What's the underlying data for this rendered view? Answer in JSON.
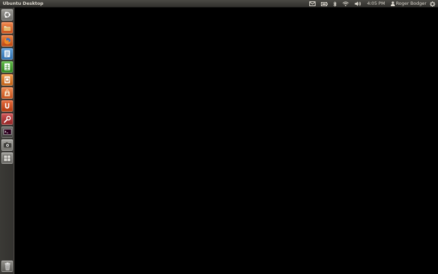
{
  "top_panel": {
    "window_title": "Ubuntu Desktop",
    "indicators": {
      "mail_icon": "envelope-icon",
      "battery_icon": "battery-icon",
      "bluetooth_icon": "bluetooth-icon",
      "network_icon": "wifi-icon",
      "sound_icon": "speaker-icon",
      "clock": "4:05 PM",
      "user_name": "Roger Bodger",
      "session_icon": "gear-icon"
    }
  },
  "launcher": {
    "items": [
      {
        "name": "dash-home",
        "icon": "ubuntu-logo-icon",
        "color": "#8d8c87"
      },
      {
        "name": "files",
        "icon": "folder-icon",
        "color": "#e1652b"
      },
      {
        "name": "firefox",
        "icon": "firefox-icon",
        "color": "#d35a1e"
      },
      {
        "name": "writer",
        "icon": "writer-document-icon",
        "color": "#3b82c4"
      },
      {
        "name": "calc",
        "icon": "calc-spreadsheet-icon",
        "color": "#3f9b2c"
      },
      {
        "name": "impress",
        "icon": "impress-presentation-icon",
        "color": "#d9731f"
      },
      {
        "name": "software-center",
        "icon": "shopping-bag-icon",
        "color": "#dd6425"
      },
      {
        "name": "ubuntu-one",
        "icon": "ubuntu-one-icon",
        "color": "#d14f1b"
      },
      {
        "name": "system-settings",
        "icon": "wrench-gear-icon",
        "color": "#b83a3a"
      },
      {
        "name": "terminal",
        "icon": "terminal-icon",
        "color": "#5a5955"
      },
      {
        "name": "screenshot",
        "icon": "camera-icon",
        "color": "#8e8d88"
      },
      {
        "name": "workspace-switcher",
        "icon": "workspace-grid-icon",
        "color": "#7f7e79"
      }
    ],
    "trash": {
      "name": "trash",
      "icon": "trash-icon",
      "color": "#7a7974"
    }
  }
}
